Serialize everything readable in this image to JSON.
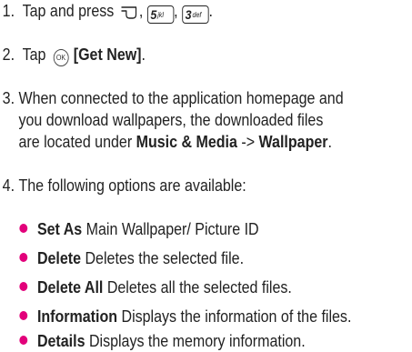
{
  "steps": [
    {
      "num": "1.",
      "text_a": "Tap and press",
      "keys": [
        {
          "main": "5",
          "sub": "jkl"
        },
        {
          "main": "3",
          "sub": "def"
        }
      ]
    },
    {
      "num": "2.",
      "text_a": "Tap",
      "ok_label": "OK",
      "bold_text": "[Get New]",
      "end": "."
    },
    {
      "num": "3.",
      "line1": "When connected to the application homepage and",
      "line2": "you download wallpapers, the downloaded files",
      "line3_a": "are located under",
      "bold_a": "Music & Media",
      "arrow": "->",
      "bold_b": "Wallpaper",
      "end": "."
    },
    {
      "num": "4.",
      "text": "The following options are available:"
    }
  ],
  "options": [
    {
      "label": "Set As",
      "desc": "Main Wallpaper/ Picture ID"
    },
    {
      "label": "Delete",
      "desc": "Deletes the selected file."
    },
    {
      "label": "Delete All",
      "desc": "Deletes all the selected files."
    },
    {
      "label": "Information",
      "desc": "Displays the information of the files."
    },
    {
      "label": "Details",
      "desc": "Displays the memory information."
    }
  ],
  "icons": {
    "menu_key": "menu-key-icon",
    "ok_key": "ok-key-icon",
    "bullet_color": "#e2007a"
  }
}
